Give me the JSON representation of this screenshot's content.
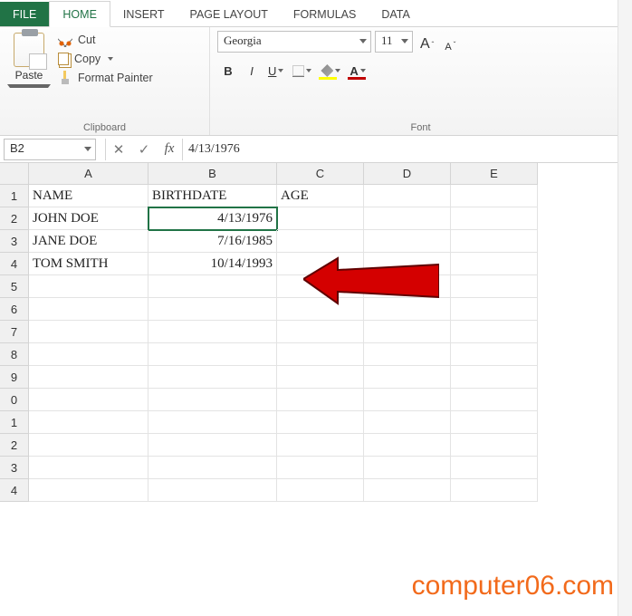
{
  "tabs": {
    "file": "FILE",
    "home": "HOME",
    "insert": "INSERT",
    "page_layout": "PAGE LAYOUT",
    "formulas": "FORMULAS",
    "data": "DATA"
  },
  "clipboard": {
    "paste": "Paste",
    "cut": "Cut",
    "copy": "Copy",
    "format_painter": "Format Painter",
    "group": "Clipboard"
  },
  "font": {
    "name": "Georgia",
    "size": "11",
    "bold": "B",
    "italic": "I",
    "underline": "U",
    "letterA": "A",
    "group": "Font"
  },
  "formula_bar": {
    "name_box": "B2",
    "cancel": "✕",
    "enter": "✓",
    "fx": "fx",
    "value": "4/13/1976"
  },
  "columns": [
    "A",
    "B",
    "C",
    "D",
    "E"
  ],
  "row_headers": [
    "1",
    "2",
    "3",
    "4",
    "5",
    "6",
    "7",
    "8",
    "9",
    "0",
    "1",
    "2",
    "3",
    "4"
  ],
  "sheet": {
    "headers": {
      "A": "NAME",
      "B": "BIRTHDATE",
      "C": "AGE"
    },
    "rows": [
      {
        "A": "JOHN DOE",
        "B": "4/13/1976"
      },
      {
        "A": "JANE DOE",
        "B": "7/16/1985"
      },
      {
        "A": "TOM SMITH",
        "B": "10/14/1993"
      }
    ]
  },
  "watermark": "computer06.com"
}
